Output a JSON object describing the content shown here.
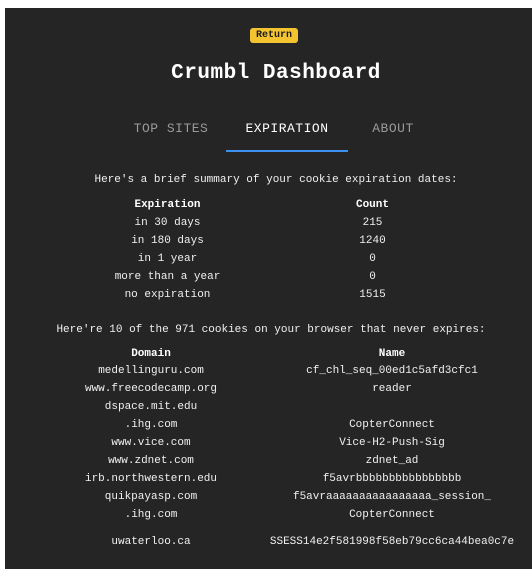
{
  "header": {
    "return_label": "Return",
    "title": "Crumbl Dashboard"
  },
  "tabs": [
    {
      "label": "TOP SITES",
      "active": false
    },
    {
      "label": "EXPIRATION",
      "active": true
    },
    {
      "label": "ABOUT",
      "active": false
    }
  ],
  "expiration": {
    "summary_text": "Here's a brief summary of your cookie expiration dates:",
    "columns": [
      "Expiration",
      "Count"
    ],
    "rows": [
      {
        "expiration": "in 30 days",
        "count": "215"
      },
      {
        "expiration": "in 180 days",
        "count": "1240"
      },
      {
        "expiration": "in 1 year",
        "count": "0"
      },
      {
        "expiration": "more than a year",
        "count": "0"
      },
      {
        "expiration": "no expiration",
        "count": "1515"
      }
    ]
  },
  "never_expires": {
    "text": "Here're 10 of the 971 cookies on your browser that never expires:",
    "columns": [
      "Domain",
      "Name"
    ],
    "rows": [
      {
        "domain": "medellinguru.com",
        "name": "cf_chl_seq_00ed1c5afd3cfc1"
      },
      {
        "domain": "www.freecodecamp.org",
        "name": "reader"
      },
      {
        "domain": "dspace.mit.edu",
        "name": ""
      },
      {
        "domain": ".ihg.com",
        "name": "CopterConnect"
      },
      {
        "domain": "www.vice.com",
        "name": "Vice-H2-Push-Sig"
      },
      {
        "domain": "www.zdnet.com",
        "name": "zdnet_ad"
      },
      {
        "domain": "irb.northwestern.edu",
        "name": "f5avrbbbbbbbbbbbbbbbb"
      },
      {
        "domain": "quikpayasp.com",
        "name": "f5avraaaaaaaaaaaaaaaa_session_"
      },
      {
        "domain": ".ihg.com",
        "name": "CopterConnect"
      },
      {
        "domain": "uwaterloo.ca",
        "name": "SSESS14e2f581998f58eb79cc6ca44bea0c7e"
      }
    ]
  },
  "colors": {
    "background": "#252525",
    "accent_button": "#f4c430",
    "tab_underline": "#3d8ff0",
    "inactive_tab": "#9a9a9a"
  }
}
